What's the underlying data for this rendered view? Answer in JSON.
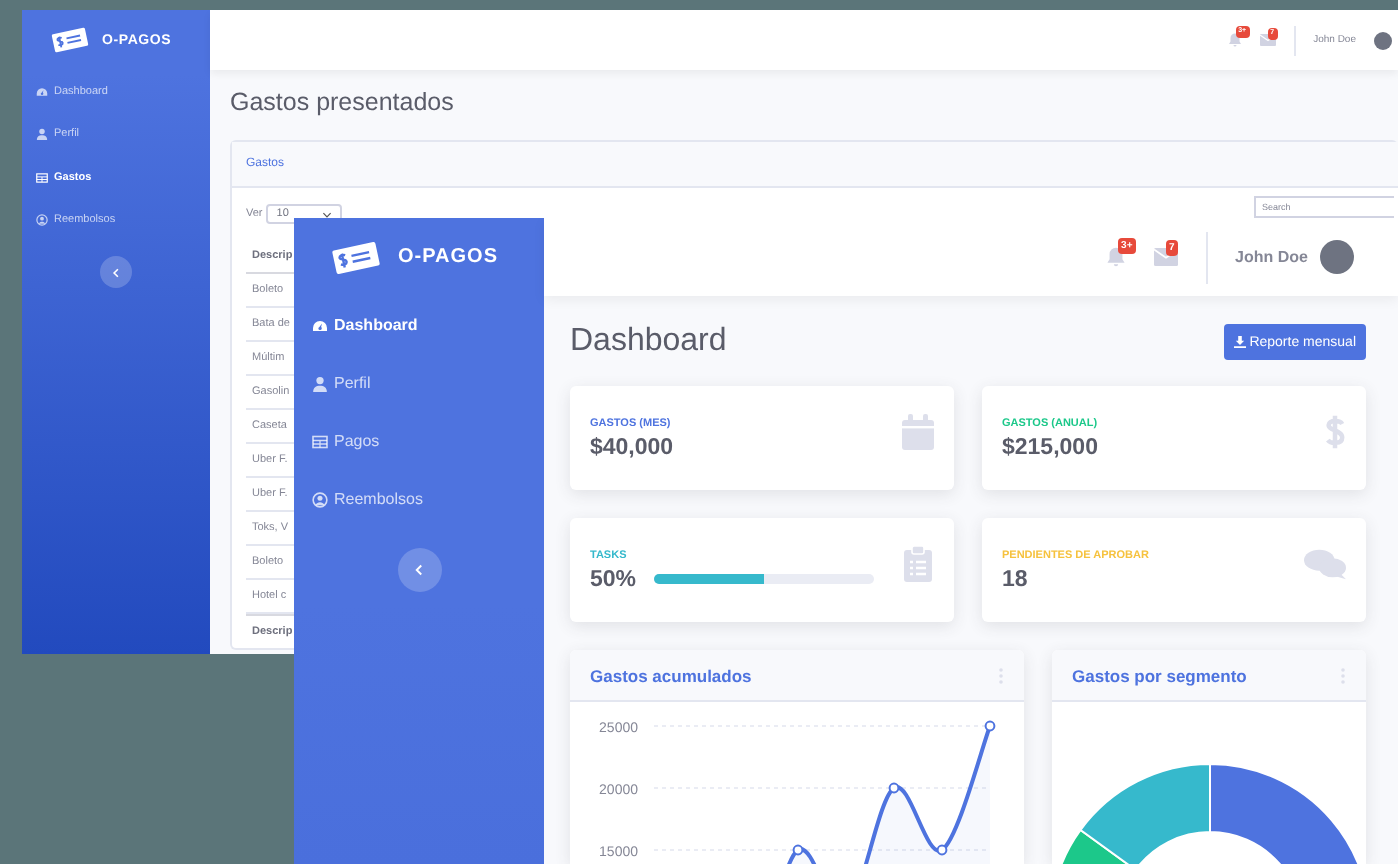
{
  "back_window": {
    "brand": "O-PAGOS",
    "sidebar": {
      "items": [
        {
          "label": "Dashboard",
          "selected": false
        },
        {
          "label": "Perfil",
          "selected": false
        },
        {
          "label": "Gastos",
          "selected": true
        },
        {
          "label": "Reembolsos",
          "selected": false
        }
      ]
    },
    "topbar": {
      "alerts_badge": "3+",
      "messages_badge": "7",
      "user_name": "John Doe"
    },
    "page_title": "Gastos presentados",
    "card": {
      "title": "Gastos",
      "length_label": "Ver",
      "length_value": "10",
      "search_placeholder": "Search",
      "table": {
        "header": "Descrip",
        "rows": [
          "Boleto",
          "Bata de",
          "Múltim",
          "Gasolin",
          "Caseta",
          "Uber F.",
          "Uber F.",
          "Toks, V",
          "Boleto",
          "Hotel c"
        ],
        "footer": "Descrip"
      }
    }
  },
  "front_window": {
    "brand": "O-PAGOS",
    "sidebar": {
      "items": [
        {
          "label": "Dashboard",
          "selected": true
        },
        {
          "label": "Perfil",
          "selected": false
        },
        {
          "label": "Pagos",
          "selected": false
        },
        {
          "label": "Reembolsos",
          "selected": false
        }
      ]
    },
    "topbar": {
      "alerts_badge": "3+",
      "messages_badge": "7",
      "user_name": "John Doe"
    },
    "page_title": "Dashboard",
    "report_button": "Reporte mensual",
    "stat_cards": [
      {
        "kind": "value",
        "label": "GASTOS (MES)",
        "value": "$40,000",
        "color": "#4e73df"
      },
      {
        "kind": "value",
        "label": "GASTOS (ANUAL)",
        "value": "$215,000",
        "color": "#1cc88a"
      },
      {
        "kind": "progress",
        "label": "TASKS",
        "value": "50%",
        "level": 0.5,
        "color": "#36b9cc"
      },
      {
        "kind": "value",
        "label": "PENDIENTES DE APROBAR",
        "value": "18",
        "color": "#f6c23e"
      }
    ],
    "chart_cards": [
      {
        "kind": "line",
        "title": "Gastos acumulados",
        "chart_data": {
          "type": "area",
          "ylim": [
            0,
            25000
          ],
          "yticks": [
            15000,
            20000,
            25000
          ],
          "series": [
            {
              "color": "#4e73df",
              "values": [
                0,
                10000,
                5000,
                15000,
                10000,
                20000,
                15000,
                25000
              ]
            }
          ]
        }
      },
      {
        "kind": "donut",
        "title": "Gastos por segmento"
      }
    ]
  }
}
